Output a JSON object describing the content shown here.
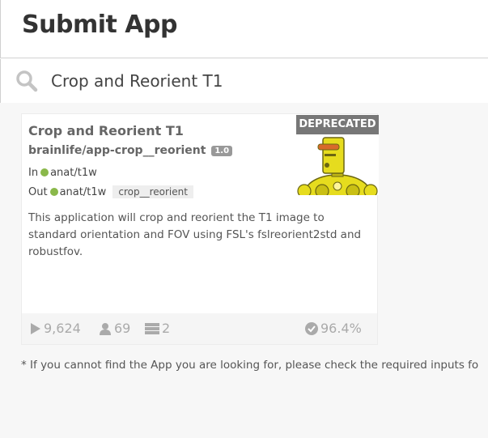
{
  "header": {
    "title": "Submit App"
  },
  "search": {
    "value": "Crop and Reorient T1",
    "icon": "search-icon"
  },
  "app_card": {
    "title": "Crop and Reorient T1",
    "repo": "brainlife/app-crop__reorient",
    "version": "1.0",
    "status_badge": "DEPRECATED",
    "inputs": {
      "label": "In",
      "datatype": "anat/t1w"
    },
    "outputs": {
      "label": "Out",
      "datatype": "anat/t1w",
      "tag": "crop__reorient"
    },
    "description": "This application will crop and reorient the T1 image to standard orientation and FOV using FSL's fslreorient2std and robustfov.",
    "stats": {
      "runs": "9,624",
      "users": "69",
      "resources": "2",
      "success_rate": "96.4%"
    },
    "colors": {
      "datatype_dot": "#8ab84a",
      "deprecated_bg": "#777777"
    }
  },
  "footnote": "* If you cannot find the App you are looking for, please check the required inputs fo"
}
